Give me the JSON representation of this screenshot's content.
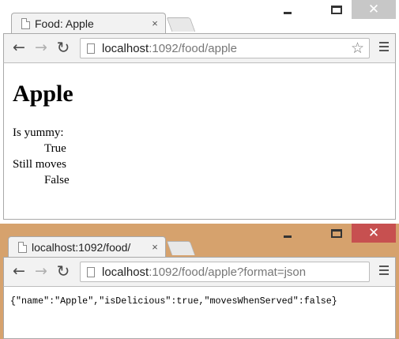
{
  "windows": [
    {
      "tab": {
        "title": "Food: Apple",
        "close": "×"
      },
      "address": {
        "host": "localhost",
        "rest": ":1092/food/apple"
      },
      "page": {
        "heading": "Apple",
        "definitions": [
          {
            "term": "Is yummy:",
            "value": "True"
          },
          {
            "term": "Still moves",
            "value": "False"
          }
        ]
      }
    },
    {
      "tab": {
        "title": "localhost:1092/food/",
        "close": "×"
      },
      "address": {
        "host": "localhost",
        "rest": ":1092/food/apple?format=json"
      },
      "page": {
        "raw_json": "{\"name\":\"Apple\",\"isDelicious\":true,\"movesWhenServed\":false}"
      }
    }
  ],
  "icons": {
    "back": "←",
    "forward": "→",
    "reload": "↻",
    "star": "☆",
    "close": "✕"
  },
  "colors": {
    "window_active_frame": "#ffffff",
    "window_inactive_frame": "#d6a26d",
    "close_active": "#c7c7c7",
    "close_inactive": "#c75050"
  }
}
